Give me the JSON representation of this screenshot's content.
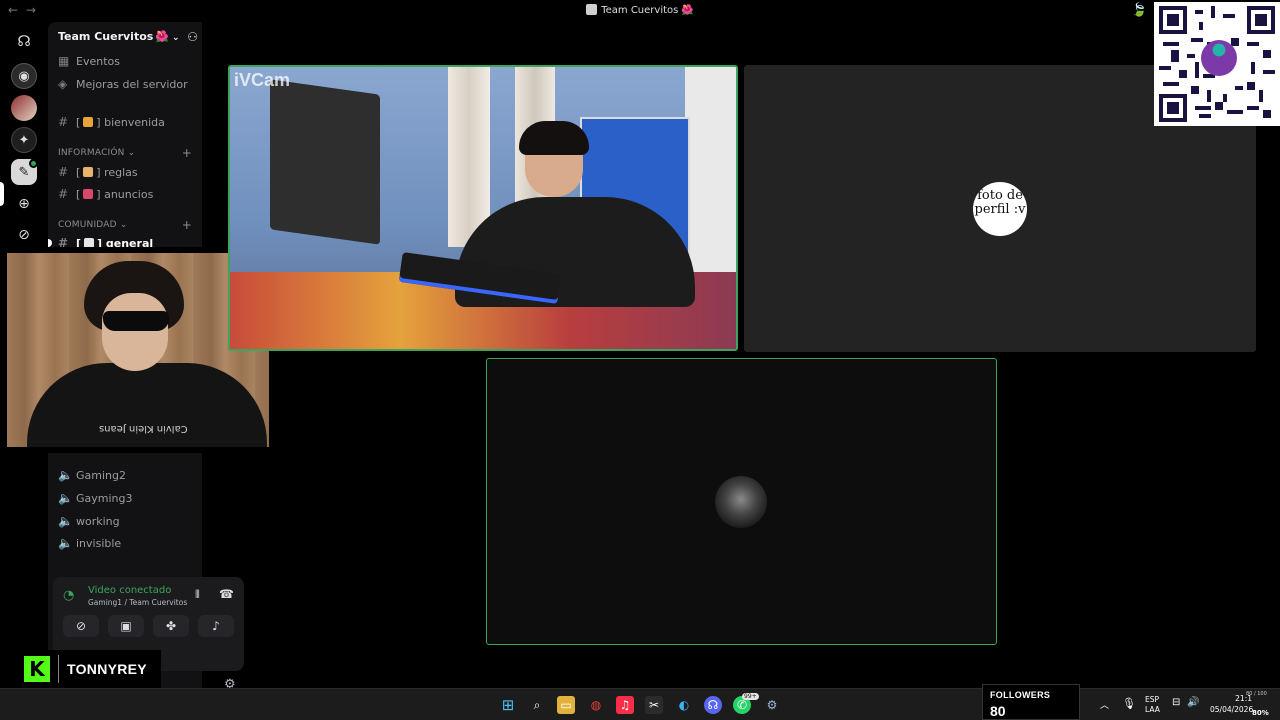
{
  "window": {
    "title": "Team Cuervitos",
    "title_emoji": "🌺",
    "nav_icons": [
      "arrow-left-icon",
      "arrow-right-icon"
    ]
  },
  "server_rail": {
    "items": [
      "discord-home",
      "server-1",
      "server-2",
      "server-3",
      "server-4",
      "add-server",
      "explore"
    ]
  },
  "sidebar": {
    "server_name": "Team Cuervitos",
    "server_emoji": "🌺",
    "top_items": [
      "Eventos",
      "Mejoras del servidor"
    ],
    "welcome_channel": "bienvenida",
    "categories": [
      {
        "name": "INFORMACIÓN",
        "channels": [
          "reglas",
          "anuncios"
        ]
      },
      {
        "name": "COMUNIDAD",
        "channels": [
          "general"
        ]
      }
    ],
    "voice_channels": [
      "Gaming2",
      "Gayming3",
      "working",
      "invisible"
    ]
  },
  "voice_panel": {
    "status": "Video conectado",
    "location": "Gaming1 / Team Cuervitos..."
  },
  "stage": {
    "tile1_watermark": "iVCam",
    "tile2_avatar_text": "foto de perfil :v"
  },
  "stream_overlay": {
    "username": "TONNYREY",
    "kick_logo": "K",
    "facecam_shirt_text": "Calvin Klein Jeans",
    "followers_label": "FOLLOWERS",
    "followers_count": "80"
  },
  "taskbar": {
    "whatsapp_badge": "99+",
    "language_line1": "ESP",
    "language_line2": "LAA",
    "time": "21:1",
    "date": "05/04/2026",
    "battery": "80%",
    "battery_fraction": "80 / 100"
  },
  "colors": {
    "accent_green": "#3ba55d",
    "kick_green": "#53fc18",
    "sidebar_bg": "#121214"
  }
}
